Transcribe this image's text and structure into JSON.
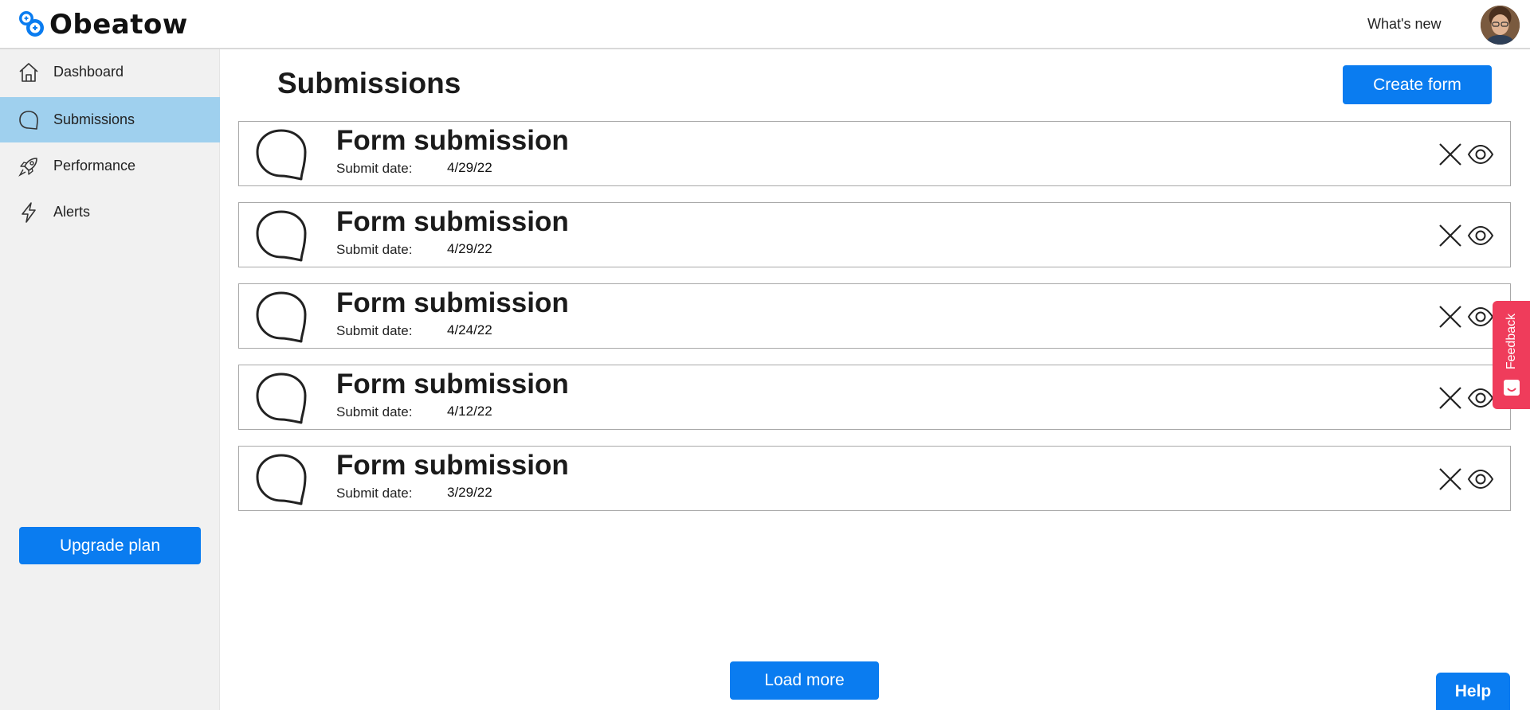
{
  "app": {
    "name": "Obeatow",
    "whats_new": "What's new"
  },
  "sidebar": {
    "items": [
      {
        "label": "Dashboard",
        "icon": "home-icon",
        "active": false
      },
      {
        "label": "Submissions",
        "icon": "chat-bubble-icon",
        "active": true
      },
      {
        "label": "Performance",
        "icon": "rocket-icon",
        "active": false
      },
      {
        "label": "Alerts",
        "icon": "lightning-icon",
        "active": false
      }
    ],
    "upgrade_label": "Upgrade plan"
  },
  "main": {
    "title": "Submissions",
    "create_label": "Create form",
    "submissions": [
      {
        "title": "Form submission",
        "date_label": "Submit date:",
        "date": "4/29/22"
      },
      {
        "title": "Form submission",
        "date_label": "Submit date:",
        "date": "4/29/22"
      },
      {
        "title": "Form submission",
        "date_label": "Submit date:",
        "date": "4/24/22"
      },
      {
        "title": "Form submission",
        "date_label": "Submit date:",
        "date": "4/12/22"
      },
      {
        "title": "Form submission",
        "date_label": "Submit date:",
        "date": "3/29/22"
      }
    ],
    "load_more_label": "Load more"
  },
  "widgets": {
    "feedback_label": "Feedback",
    "help_label": "Help"
  },
  "colors": {
    "primary": "#0a7cf0",
    "active_nav": "#9fd0ee",
    "sidebar_bg": "#f1f1f1",
    "feedback": "#ef3c5b"
  }
}
